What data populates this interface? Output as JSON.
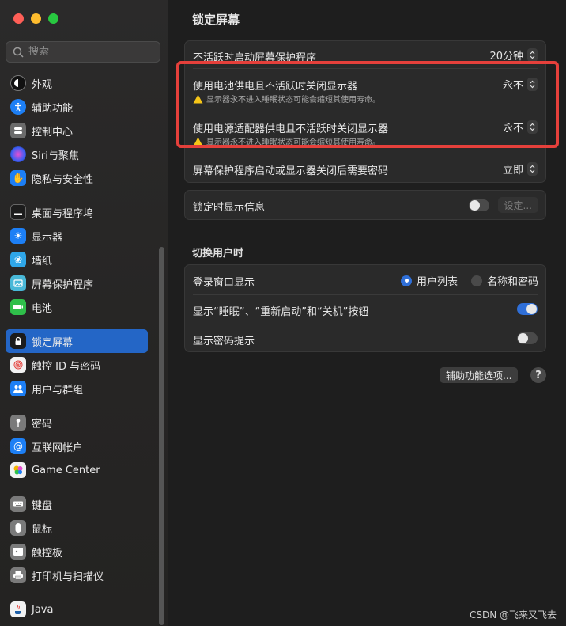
{
  "sidebar": {
    "search_placeholder": "搜索",
    "items": [
      {
        "label": "外观",
        "icon": "appearance-icon",
        "color": "#1c1c1c"
      },
      {
        "label": "辅助功能",
        "icon": "accessibility-icon",
        "color": "#1d7ff5"
      },
      {
        "label": "控制中心",
        "icon": "control-center-icon",
        "color": "#6b6b6b"
      },
      {
        "label": "Siri与聚焦",
        "icon": "siri-icon",
        "color": "#8a4bd6"
      },
      {
        "label": "隐私与安全性",
        "icon": "hand-icon",
        "color": "#1d7ff5"
      },
      {
        "label": "桌面与程序坞",
        "icon": "dock-icon",
        "color": "#1c1c1c"
      },
      {
        "label": "显示器",
        "icon": "display-icon",
        "color": "#1d7ff5"
      },
      {
        "label": "墙纸",
        "icon": "wallpaper-icon",
        "color": "#2fa6e8"
      },
      {
        "label": "屏幕保护程序",
        "icon": "screensaver-icon",
        "color": "#49b8d8"
      },
      {
        "label": "电池",
        "icon": "battery-icon",
        "color": "#2fbf4a"
      },
      {
        "label": "锁定屏幕",
        "icon": "lock-icon",
        "color": "#1c1c1c"
      },
      {
        "label": "触控 ID 与密码",
        "icon": "fingerprint-icon",
        "color": "#f2f2f2"
      },
      {
        "label": "用户与群组",
        "icon": "users-icon",
        "color": "#1d7ff5"
      },
      {
        "label": "密码",
        "icon": "key-icon",
        "color": "#7a7a7a"
      },
      {
        "label": "互联网帐户",
        "icon": "at-icon",
        "color": "#1d7ff5"
      },
      {
        "label": "Game Center",
        "icon": "game-center-icon",
        "color": "#f2f2f2"
      },
      {
        "label": "键盘",
        "icon": "keyboard-icon",
        "color": "#7a7a7a"
      },
      {
        "label": "鼠标",
        "icon": "mouse-icon",
        "color": "#7a7a7a"
      },
      {
        "label": "触控板",
        "icon": "trackpad-icon",
        "color": "#7a7a7a"
      },
      {
        "label": "打印机与扫描仪",
        "icon": "printer-icon",
        "color": "#7a7a7a"
      },
      {
        "label": "Java",
        "icon": "java-icon",
        "color": "#f2f2f2"
      }
    ],
    "active_index": 10
  },
  "main": {
    "title": "锁定屏幕",
    "group1": {
      "rows": [
        {
          "label": "不活跃时启动屏幕保护程序",
          "value": "20分钟"
        },
        {
          "label": "使用电池供电且不活跃时关闭显示器",
          "value": "永不",
          "warning": "显示器永不进入睡眠状态可能会缩短其使用寿命。"
        },
        {
          "label": "使用电源适配器供电且不活跃时关闭显示器",
          "value": "永不",
          "warning": "显示器永不进入睡眠状态可能会缩短其使用寿命。"
        },
        {
          "label": "屏幕保护程序启动或显示器关闭后需要密码",
          "value": "立即"
        }
      ]
    },
    "group2": {
      "label": "锁定时显示信息",
      "toggle_on": false,
      "button": "设定..."
    },
    "section_title": "切换用户时",
    "group3": {
      "login_label": "登录窗口显示",
      "radio_options": [
        "用户列表",
        "名称和密码"
      ],
      "radio_selected": 0,
      "buttons_label": "显示“睡眠”、“重新启动”和“关机”按钮",
      "buttons_toggle_on": true,
      "hint_label": "显示密码提示",
      "hint_toggle_on": false
    },
    "accessibility_button": "辅助功能选项...",
    "help": "?"
  },
  "watermark": "CSDN @飞来又飞去",
  "colors": {
    "accent": "#2466c6",
    "highlight": "#e5403b",
    "warning": "#f5c518"
  }
}
